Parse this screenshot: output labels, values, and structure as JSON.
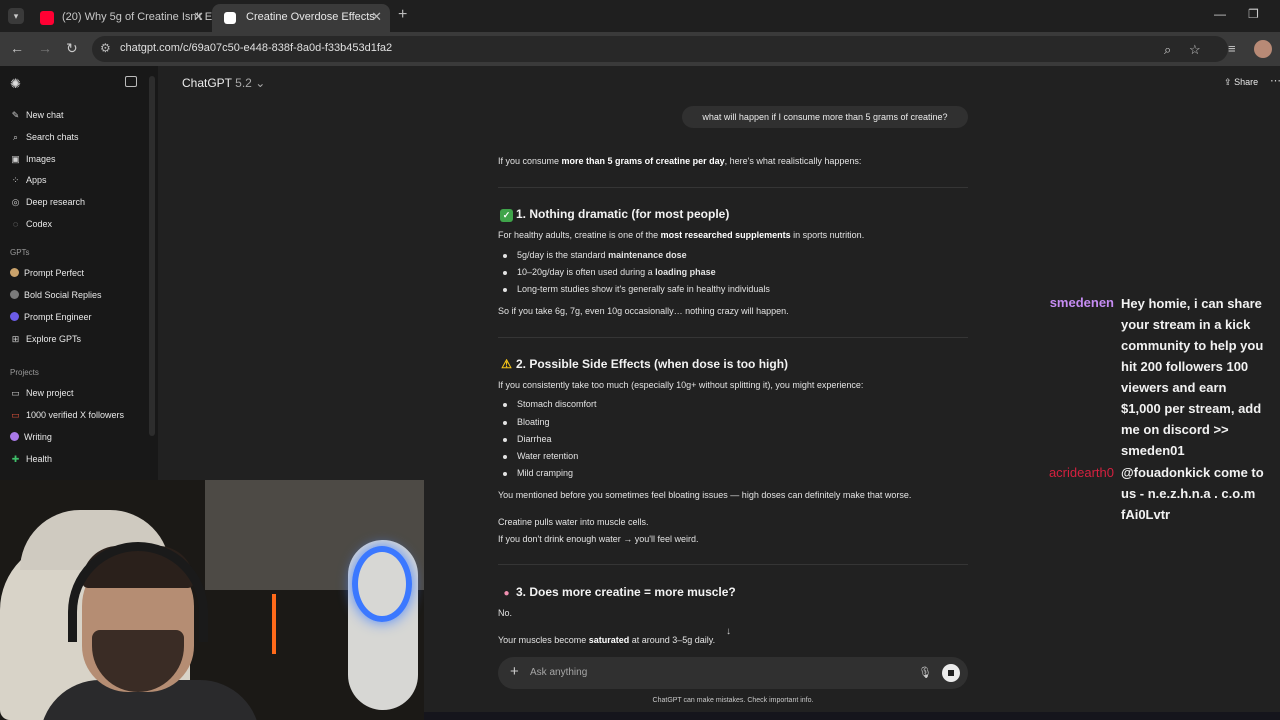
{
  "browser": {
    "tabs": [
      {
        "title": "(20) Why 5g of Creatine Isn't Er",
        "favicon": "youtube-icon"
      },
      {
        "title": "Creatine Overdose Effects",
        "favicon": "chatgpt-icon"
      }
    ],
    "url": "chatgpt.com/c/69a07c50-e448-838f-8a0d-f33b453d1fa2"
  },
  "sidebar": {
    "top_items": [
      {
        "label": "New chat",
        "icon": "edit-icon"
      },
      {
        "label": "Search chats",
        "icon": "search-icon"
      },
      {
        "label": "Images",
        "icon": "image-icon"
      },
      {
        "label": "Apps",
        "icon": "apps-icon"
      },
      {
        "label": "Deep research",
        "icon": "research-icon"
      },
      {
        "label": "Codex",
        "icon": "codex-icon"
      }
    ],
    "gpts_heading": "GPTs",
    "gpts": [
      {
        "label": "Prompt Perfect",
        "color": "#c9a26b"
      },
      {
        "label": "Bold Social Replies",
        "color": "#7a7a7a"
      },
      {
        "label": "Prompt Engineer",
        "color": "#6c5ce7"
      },
      {
        "label": "Explore GPTs",
        "color": "#9a9a9a"
      }
    ],
    "projects_heading": "Projects",
    "projects": [
      {
        "label": "New project",
        "color": "#cfcfcf"
      },
      {
        "label": "1000 verified X followers",
        "color": "#e0533d"
      },
      {
        "label": "Writing",
        "color": "#a979e8"
      },
      {
        "label": "Health",
        "color": "#3fbf6a"
      }
    ]
  },
  "header": {
    "model_name": "ChatGPT",
    "model_version": "5.2",
    "share_label": "Share"
  },
  "conversation": {
    "user_message": "what will happen if I consume more than 5 grams of creatine?",
    "intro": {
      "pre": "If you consume ",
      "bold": "more than 5 grams of creatine per day",
      "post": ", here's what realistically happens:"
    },
    "section1": {
      "heading": "1. Nothing dramatic (for most people)",
      "para": {
        "pre": "For healthy adults, creatine is one of the ",
        "bold": "most researched supplements",
        "post": " in sports nutrition."
      },
      "bullets": [
        {
          "pre": "5g/day is the standard ",
          "bold": "maintenance dose"
        },
        {
          "pre": "10–20g/day is often used during a ",
          "bold": "loading phase"
        },
        {
          "pre": "Long-term studies show it's generally safe in healthy individuals",
          "bold": ""
        }
      ],
      "closing": "So if you take 6g, 7g, even 10g occasionally… nothing crazy will happen."
    },
    "section2": {
      "heading": "2. Possible Side Effects (when dose is too high)",
      "intro": "If you consistently take too much (especially 10g+ without splitting it), you might experience:",
      "bullets": [
        "Stomach discomfort",
        "Bloating",
        "Diarrhea",
        "Water retention",
        "Mild cramping"
      ],
      "note1": "You mentioned before you sometimes feel bloating issues — high doses can definitely make that worse.",
      "note2": "Creatine pulls water into muscle cells.",
      "note3": "If you don't drink enough water → you'll feel weird."
    },
    "section3": {
      "heading": "3. Does more creatine = more muscle?",
      "answer": "No.",
      "para": {
        "pre": "Your muscles become ",
        "bold": "saturated",
        "post": " at around 3–5g daily."
      }
    }
  },
  "composer": {
    "placeholder": "Ask anything",
    "disclaimer": "ChatGPT can make mistakes. Check important info."
  },
  "stream_chat": [
    {
      "user": "smedenen",
      "user_color": "#c58cf2",
      "lines": [
        "Hey homie, i can share",
        "your stream in a kick",
        "community to help you",
        "hit 200 followers 100",
        "viewers and earn",
        "$1,000 per stream, add",
        "me on discord >>",
        "smeden01"
      ]
    },
    {
      "user": "acridearth0",
      "user_color": "#d4213f",
      "lines": [
        "@fouadonkick come to",
        "us - n.e.z.h.n.a . c.o.m",
        "fAi0Lvtr"
      ]
    }
  ]
}
